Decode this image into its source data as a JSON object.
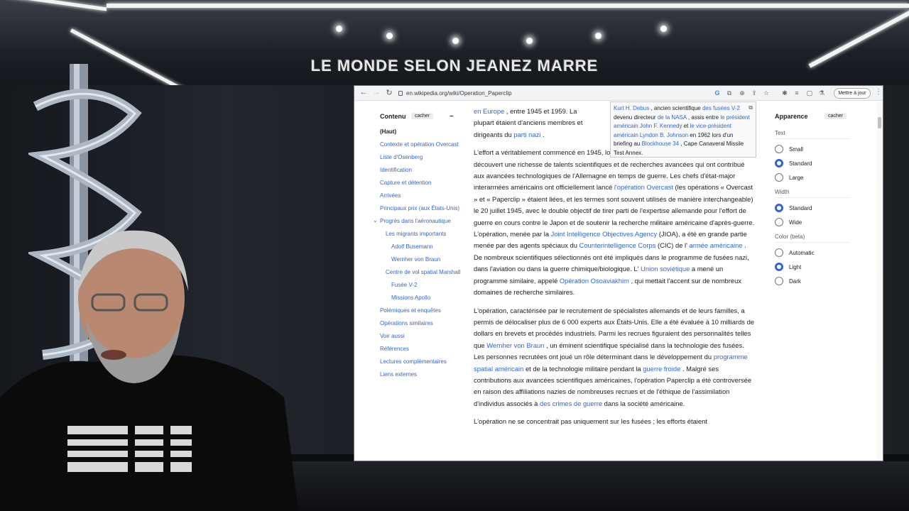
{
  "show_title": "LE MONDE SELON JEANEZ MARRE",
  "browser": {
    "url": "en.wikipedia.org/wiki/Operation_Paperclip",
    "update_button": "Mettre à jour",
    "toolbar_icons": [
      "back-icon",
      "forward-icon",
      "reload-icon",
      "google-icon",
      "translate-icon",
      "zoom-icon",
      "share-icon",
      "star-icon",
      "extensions-icon",
      "reading-list-icon",
      "sidebar-icon",
      "lab-icon",
      "profile-icon"
    ]
  },
  "toc": {
    "title": "Contenu",
    "hide": "cacher",
    "items": [
      {
        "label": "(Haut)",
        "level": 1
      },
      {
        "label": "Contexte et opération Overcast",
        "level": 1
      },
      {
        "label": "Liste d'Osenberg",
        "level": 1
      },
      {
        "label": "Identification",
        "level": 1
      },
      {
        "label": "Capture et détention",
        "level": 1
      },
      {
        "label": "Arrivées",
        "level": 1
      },
      {
        "label": "Principaux prix (aux États-Unis)",
        "level": 1
      },
      {
        "label": "Progrès dans l'aéronautique",
        "level": 1
      },
      {
        "label": "Les migrants importants",
        "level": 2
      },
      {
        "label": "Adolf Busemann",
        "level": 3
      },
      {
        "label": "Wernher von Braun",
        "level": 3
      },
      {
        "label": "Centre de vol spatial Marshall",
        "level": 2
      },
      {
        "label": "Fusée V-2",
        "level": 3
      },
      {
        "label": "Missions Apollo",
        "level": 3
      },
      {
        "label": "Polémiques et enquêtes",
        "level": 1
      },
      {
        "label": "Opérations similaires",
        "level": 1
      },
      {
        "label": "Voir aussi",
        "level": 1
      },
      {
        "label": "Références",
        "level": 1
      },
      {
        "label": "Lectures complémentaires",
        "level": 1
      },
      {
        "label": "Liens externes",
        "level": 1
      }
    ]
  },
  "article": {
    "p0": {
      "a": "en Europe",
      "b": " , entre 1945 et 1959. La plupart étaient d'anciens membres et dirigeants du ",
      "c": "parti nazi",
      "d": " ."
    },
    "p1": {
      "t1": "L'effort a véritablement commencé en 1945, lorsque les Alliés ont avancé en Allemagne et ont découvert une richesse de talents scientifiques et de recherches avancées qui ont contribué aux avancées technologiques de l'Allemagne en temps de guerre. Les chefs d'état-major interarmées américains ont officiellement lancé ",
      "l1": "l'opération Overcast",
      "t2": " (les opérations « Overcast » et « Paperclip » étaient liées, et les termes sont souvent utilisés de manière interchangeable) le 20 juillet 1945, avec le double objectif de tirer parti de l'expertise allemande pour l'effort de guerre en cours contre le Japon et de soutenir la recherche militaire américaine d'après-guerre. L'opération, menée par la ",
      "l2": "Joint Intelligence Objectives Agency",
      "t3": " (JIOA), a été en grande partie menée par des agents spéciaux du ",
      "l3": "Counterintelligence Corps",
      "t4": " (CIC) de l' ",
      "l4": "armée américaine",
      "t5": " . De nombreux scientifiques sélectionnés ont été impliqués dans le programme de fusées nazi, dans l'aviation ou dans la guerre chimique/biologique. L' ",
      "l5": "Union soviétique",
      "t6": " a mené un programme similaire, appelé ",
      "l6": "Opération Osoaviakhim",
      "t7": " , qui mettait l'accent sur de nombreux domaines de recherche similaires."
    },
    "p2": {
      "t1": "L'opération, caractérisée par le recrutement de spécialistes allemands et de leurs familles, a permis de délocaliser plus de 6 000 experts aux États-Unis. Elle a été évaluée à 10 milliards de dollars en brevets et procédés industriels. Parmi les recrues figuraient des personnalités telles que ",
      "l1": "Wernher von Braun",
      "t2": " , un éminent scientifique spécialisé dans la technologie des fusées. Les personnes recrutées ont joué un rôle déterminant dans le développement du ",
      "l2": "programme spatial américain",
      "t3": " et de la technologie militaire pendant la ",
      "l3": "guerre froide",
      "t4": " . Malgré ses contributions aux avancées scientifiques américaines, l'opération Paperclip a été controversée en raison des affiliations nazies de nombreuses recrues et de l'éthique de l'assimilation d'individus associés à ",
      "l4": "des crimes de guerre",
      "t5": " dans la société américaine."
    },
    "p3": "L'opération ne se concentrait pas uniquement sur les fusées ; les efforts étaient"
  },
  "caption": {
    "l1": "Kurt H. Debus",
    "t1": " , ancien scientifique ",
    "l2": "des fusées V-2",
    "t2": " devenu directeur ",
    "l3": "de la NASA",
    "t3": " , assis entre ",
    "l4": "le président américain John F. Kennedy",
    "t4": " et ",
    "l5": "le vice-président américain Lyndon B. Johnson",
    "t5": " en 1962 lors d'un briefing au ",
    "l6": "Blockhouse 34",
    "t6": " , Cape Canaveral Missile Test Annex."
  },
  "appearance": {
    "title": "Apparence",
    "hide": "cacher",
    "text_label": "Text",
    "text_options": [
      "Small",
      "Standard",
      "Large"
    ],
    "text_selected": "Standard",
    "width_label": "Width",
    "width_options": [
      "Standard",
      "Wide"
    ],
    "width_selected": "Standard",
    "color_label": "Color (beta)",
    "color_options": [
      "Automatic",
      "Light",
      "Dark"
    ],
    "color_selected": "Light"
  },
  "colors": {
    "link": "#3366cc",
    "radio_on": "#3366cc",
    "text": "#202122"
  }
}
